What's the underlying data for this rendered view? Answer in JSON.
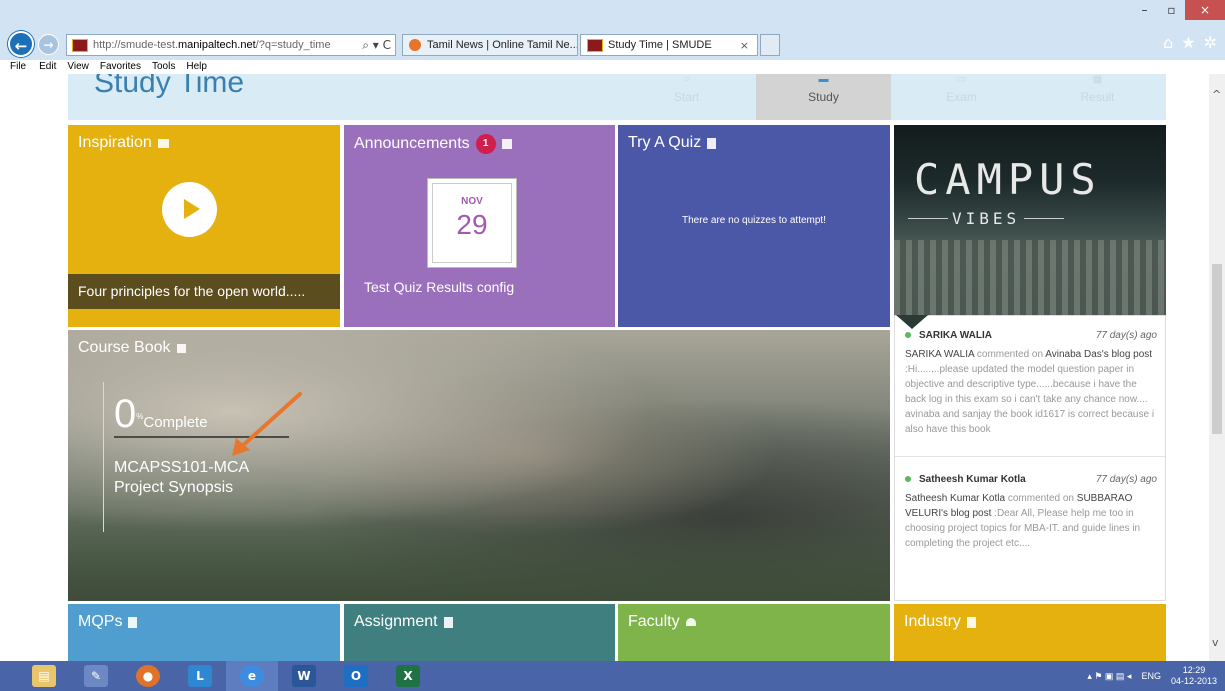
{
  "browser": {
    "url_prefix": "http://smude-test.",
    "url_host": "manipaltech.net",
    "url_suffix": "/?q=study_time",
    "addr_tools": "⌕ ▾ C",
    "tabs": [
      {
        "title": "Tamil News | Online Tamil Ne...",
        "active": false
      },
      {
        "title": "Study Time | SMUDE",
        "active": true
      }
    ],
    "tab_close": "×",
    "window_buttons": {
      "minimize": "–",
      "restore": "▫",
      "close": "×"
    },
    "tool_icons": {
      "home": "⌂",
      "favorites": "★",
      "settings": "✲"
    },
    "menu": [
      "File",
      "Edit",
      "View",
      "Favorites",
      "Tools",
      "Help"
    ]
  },
  "page": {
    "title": "Study Time",
    "steps": [
      {
        "label": "Start",
        "icon": "○",
        "active": false
      },
      {
        "label": "Study",
        "icon": "▬",
        "active": true
      },
      {
        "label": "Exam",
        "icon": "▭",
        "active": false
      },
      {
        "label": "Result",
        "icon": "▦",
        "active": false
      }
    ]
  },
  "tiles": {
    "inspiration": {
      "title": "Inspiration",
      "caption": "Four principles for the open world....."
    },
    "announcements": {
      "title": "Announcements",
      "badge": "1",
      "cal_month": "NOV",
      "cal_day": "29",
      "caption": "Test Quiz Results config"
    },
    "quiz": {
      "title": "Try A Quiz",
      "message": "There are no quizzes to attempt!"
    },
    "campus": {
      "word": "CAMPUS",
      "sub": "VIBES"
    },
    "course": {
      "title": "Course Book",
      "percent": "0",
      "percent_sign": "%",
      "complete": "Complete",
      "progress": 0,
      "name_line1": "MCAPSS101-MCA",
      "name_line2": "Project Synopsis"
    },
    "bottom": {
      "mqps": "MQPs",
      "assignment": "Assignment",
      "faculty": "Faculty",
      "industry": "Industry"
    }
  },
  "feed": [
    {
      "name": "SARIKA WALIA",
      "time": "77 day(s) ago",
      "actor": "SARIKA WALIA",
      "verb": " commented on ",
      "target": "Avinaba Das's blog post",
      "text": " :Hi........please updated the model question paper in objective and descriptive type......because i have the back log in this exam so i can't take any chance now.... avinaba and sanjay the book id1617 is correct because i also have this book"
    },
    {
      "name": "Satheesh Kumar Kotla",
      "time": "77 day(s) ago",
      "actor": "Satheesh Kumar Kotla",
      "verb": " commented on ",
      "target": "SUBBARAO VELURI's blog post",
      "text": " :Dear All, Please help me too in choosing project topics for MBA-IT. and guide lines in completing the project etc...."
    }
  ],
  "taskbar": {
    "apps": [
      {
        "name": "explorer",
        "glyph": "▤",
        "color": "#e9c66b"
      },
      {
        "name": "paint",
        "glyph": "✎",
        "color": "#6d88c4"
      },
      {
        "name": "firefox",
        "glyph": "●",
        "color": "#e0732b"
      },
      {
        "name": "lync",
        "glyph": "L",
        "color": "#2f86d1"
      },
      {
        "name": "ie",
        "glyph": "e",
        "color": "#3c8de0"
      },
      {
        "name": "word",
        "glyph": "W",
        "color": "#2b579a"
      },
      {
        "name": "outlook",
        "glyph": "O",
        "color": "#1e6fc1"
      },
      {
        "name": "excel",
        "glyph": "X",
        "color": "#207245"
      }
    ],
    "tray_icons": "▴  ⚑  ▣  ▤  ◂",
    "lang": "ENG",
    "time": "12:29",
    "date": "04-12-2013"
  }
}
